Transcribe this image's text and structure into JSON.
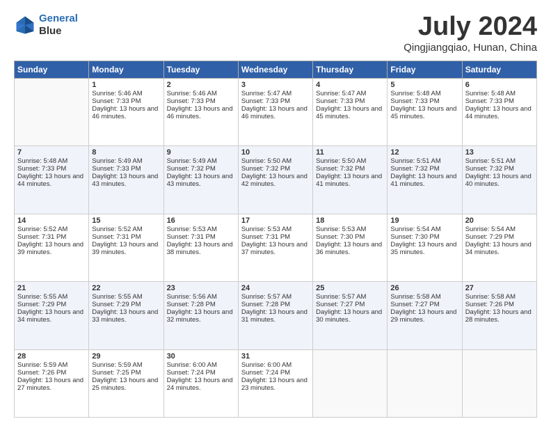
{
  "header": {
    "logo_line1": "General",
    "logo_line2": "Blue",
    "month_year": "July 2024",
    "location": "Qingjiangqiao, Hunan, China"
  },
  "days_of_week": [
    "Sunday",
    "Monday",
    "Tuesday",
    "Wednesday",
    "Thursday",
    "Friday",
    "Saturday"
  ],
  "weeks": [
    [
      {
        "day": "",
        "sunrise": "",
        "sunset": "",
        "daylight": ""
      },
      {
        "day": "1",
        "sunrise": "Sunrise: 5:46 AM",
        "sunset": "Sunset: 7:33 PM",
        "daylight": "Daylight: 13 hours and 46 minutes."
      },
      {
        "day": "2",
        "sunrise": "Sunrise: 5:46 AM",
        "sunset": "Sunset: 7:33 PM",
        "daylight": "Daylight: 13 hours and 46 minutes."
      },
      {
        "day": "3",
        "sunrise": "Sunrise: 5:47 AM",
        "sunset": "Sunset: 7:33 PM",
        "daylight": "Daylight: 13 hours and 46 minutes."
      },
      {
        "day": "4",
        "sunrise": "Sunrise: 5:47 AM",
        "sunset": "Sunset: 7:33 PM",
        "daylight": "Daylight: 13 hours and 45 minutes."
      },
      {
        "day": "5",
        "sunrise": "Sunrise: 5:48 AM",
        "sunset": "Sunset: 7:33 PM",
        "daylight": "Daylight: 13 hours and 45 minutes."
      },
      {
        "day": "6",
        "sunrise": "Sunrise: 5:48 AM",
        "sunset": "Sunset: 7:33 PM",
        "daylight": "Daylight: 13 hours and 44 minutes."
      }
    ],
    [
      {
        "day": "7",
        "sunrise": "Sunrise: 5:48 AM",
        "sunset": "Sunset: 7:33 PM",
        "daylight": "Daylight: 13 hours and 44 minutes."
      },
      {
        "day": "8",
        "sunrise": "Sunrise: 5:49 AM",
        "sunset": "Sunset: 7:33 PM",
        "daylight": "Daylight: 13 hours and 43 minutes."
      },
      {
        "day": "9",
        "sunrise": "Sunrise: 5:49 AM",
        "sunset": "Sunset: 7:32 PM",
        "daylight": "Daylight: 13 hours and 43 minutes."
      },
      {
        "day": "10",
        "sunrise": "Sunrise: 5:50 AM",
        "sunset": "Sunset: 7:32 PM",
        "daylight": "Daylight: 13 hours and 42 minutes."
      },
      {
        "day": "11",
        "sunrise": "Sunrise: 5:50 AM",
        "sunset": "Sunset: 7:32 PM",
        "daylight": "Daylight: 13 hours and 41 minutes."
      },
      {
        "day": "12",
        "sunrise": "Sunrise: 5:51 AM",
        "sunset": "Sunset: 7:32 PM",
        "daylight": "Daylight: 13 hours and 41 minutes."
      },
      {
        "day": "13",
        "sunrise": "Sunrise: 5:51 AM",
        "sunset": "Sunset: 7:32 PM",
        "daylight": "Daylight: 13 hours and 40 minutes."
      }
    ],
    [
      {
        "day": "14",
        "sunrise": "Sunrise: 5:52 AM",
        "sunset": "Sunset: 7:31 PM",
        "daylight": "Daylight: 13 hours and 39 minutes."
      },
      {
        "day": "15",
        "sunrise": "Sunrise: 5:52 AM",
        "sunset": "Sunset: 7:31 PM",
        "daylight": "Daylight: 13 hours and 39 minutes."
      },
      {
        "day": "16",
        "sunrise": "Sunrise: 5:53 AM",
        "sunset": "Sunset: 7:31 PM",
        "daylight": "Daylight: 13 hours and 38 minutes."
      },
      {
        "day": "17",
        "sunrise": "Sunrise: 5:53 AM",
        "sunset": "Sunset: 7:31 PM",
        "daylight": "Daylight: 13 hours and 37 minutes."
      },
      {
        "day": "18",
        "sunrise": "Sunrise: 5:53 AM",
        "sunset": "Sunset: 7:30 PM",
        "daylight": "Daylight: 13 hours and 36 minutes."
      },
      {
        "day": "19",
        "sunrise": "Sunrise: 5:54 AM",
        "sunset": "Sunset: 7:30 PM",
        "daylight": "Daylight: 13 hours and 35 minutes."
      },
      {
        "day": "20",
        "sunrise": "Sunrise: 5:54 AM",
        "sunset": "Sunset: 7:29 PM",
        "daylight": "Daylight: 13 hours and 34 minutes."
      }
    ],
    [
      {
        "day": "21",
        "sunrise": "Sunrise: 5:55 AM",
        "sunset": "Sunset: 7:29 PM",
        "daylight": "Daylight: 13 hours and 34 minutes."
      },
      {
        "day": "22",
        "sunrise": "Sunrise: 5:55 AM",
        "sunset": "Sunset: 7:29 PM",
        "daylight": "Daylight: 13 hours and 33 minutes."
      },
      {
        "day": "23",
        "sunrise": "Sunrise: 5:56 AM",
        "sunset": "Sunset: 7:28 PM",
        "daylight": "Daylight: 13 hours and 32 minutes."
      },
      {
        "day": "24",
        "sunrise": "Sunrise: 5:57 AM",
        "sunset": "Sunset: 7:28 PM",
        "daylight": "Daylight: 13 hours and 31 minutes."
      },
      {
        "day": "25",
        "sunrise": "Sunrise: 5:57 AM",
        "sunset": "Sunset: 7:27 PM",
        "daylight": "Daylight: 13 hours and 30 minutes."
      },
      {
        "day": "26",
        "sunrise": "Sunrise: 5:58 AM",
        "sunset": "Sunset: 7:27 PM",
        "daylight": "Daylight: 13 hours and 29 minutes."
      },
      {
        "day": "27",
        "sunrise": "Sunrise: 5:58 AM",
        "sunset": "Sunset: 7:26 PM",
        "daylight": "Daylight: 13 hours and 28 minutes."
      }
    ],
    [
      {
        "day": "28",
        "sunrise": "Sunrise: 5:59 AM",
        "sunset": "Sunset: 7:26 PM",
        "daylight": "Daylight: 13 hours and 27 minutes."
      },
      {
        "day": "29",
        "sunrise": "Sunrise: 5:59 AM",
        "sunset": "Sunset: 7:25 PM",
        "daylight": "Daylight: 13 hours and 25 minutes."
      },
      {
        "day": "30",
        "sunrise": "Sunrise: 6:00 AM",
        "sunset": "Sunset: 7:24 PM",
        "daylight": "Daylight: 13 hours and 24 minutes."
      },
      {
        "day": "31",
        "sunrise": "Sunrise: 6:00 AM",
        "sunset": "Sunset: 7:24 PM",
        "daylight": "Daylight: 13 hours and 23 minutes."
      },
      {
        "day": "",
        "sunrise": "",
        "sunset": "",
        "daylight": ""
      },
      {
        "day": "",
        "sunrise": "",
        "sunset": "",
        "daylight": ""
      },
      {
        "day": "",
        "sunrise": "",
        "sunset": "",
        "daylight": ""
      }
    ]
  ]
}
